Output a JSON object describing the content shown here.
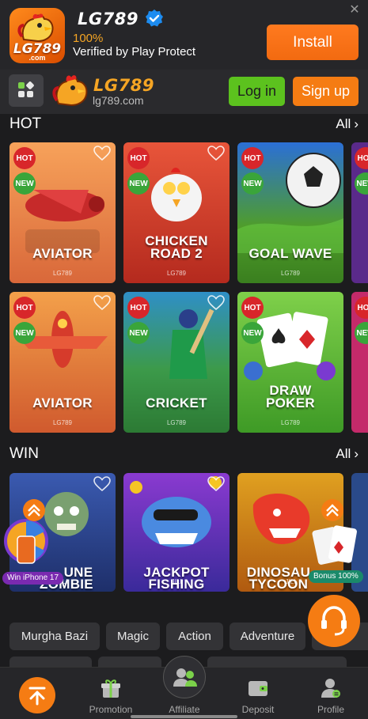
{
  "banner": {
    "app_title": "LG789",
    "app_icon_text": "LG789",
    "app_icon_sub": ".com",
    "rating": "100%",
    "subtitle": "Verified by Play Protect",
    "install_label": "Install",
    "close_glyph": "✕"
  },
  "header": {
    "logo_text": "LG789",
    "domain": "lg789.com",
    "login_label": "Log in",
    "signup_label": "Sign up"
  },
  "sections": {
    "hot": {
      "title": "HOT",
      "all_label": "All"
    },
    "win": {
      "title": "WIN",
      "all_label": "All"
    }
  },
  "tags": {
    "hot": "HOT",
    "new": "NEW"
  },
  "hot_games": [
    {
      "name_line1": "AVIATOR",
      "name_line2": "",
      "brand": "LG789"
    },
    {
      "name_line1": "CHICKEN",
      "name_line2": "ROAD 2",
      "brand": "LG789"
    },
    {
      "name_line1": "GOAL WAVE",
      "name_line2": "",
      "brand": "LG789"
    },
    {
      "name_line1": "AVIATOR",
      "name_line2": "",
      "brand": "LG789"
    },
    {
      "name_line1": "CRICKET",
      "name_line2": "",
      "brand": "LG789"
    },
    {
      "name_line1": "DRAW",
      "name_line2": "POKER",
      "brand": "LG789"
    }
  ],
  "win_games": [
    {
      "name_line1": "UNE",
      "name_line2": "ZOMBIE",
      "brand": "JILI"
    },
    {
      "name_line1": "JACKPOT",
      "name_line2": "FISHING",
      "brand": "JILI"
    },
    {
      "name_line1": "DINOSAU",
      "name_line2": "TYCOON",
      "brand": "JILI"
    }
  ],
  "promos": {
    "win_iphone": "Win iPhone 17",
    "bonus": "Bonus 100%"
  },
  "categories": [
    "Murgha Bazi",
    "Magic",
    "Action",
    "Adventure"
  ],
  "nav": {
    "promotion": "Promotion",
    "affiliate": "Affiliate",
    "deposit": "Deposit",
    "profile": "Profile"
  },
  "colors": {
    "accent": "#f57c13",
    "login_green": "#5cc21e",
    "hot_red": "#d8262a",
    "new_green": "#3aa53a",
    "verified_blue": "#1d8cf0",
    "logo_gold": "#f5a524"
  },
  "icons": {
    "close": "close-icon",
    "verified": "verified-badge-icon",
    "menu": "apps-grid-icon",
    "favorite": "heart-icon",
    "chevron": "chevron-right-icon",
    "back_to_top": "arrow-up-icon",
    "promotion": "gift-icon",
    "affiliate": "users-icon",
    "deposit": "wallet-icon",
    "profile": "user-icon",
    "support": "headset-icon"
  }
}
